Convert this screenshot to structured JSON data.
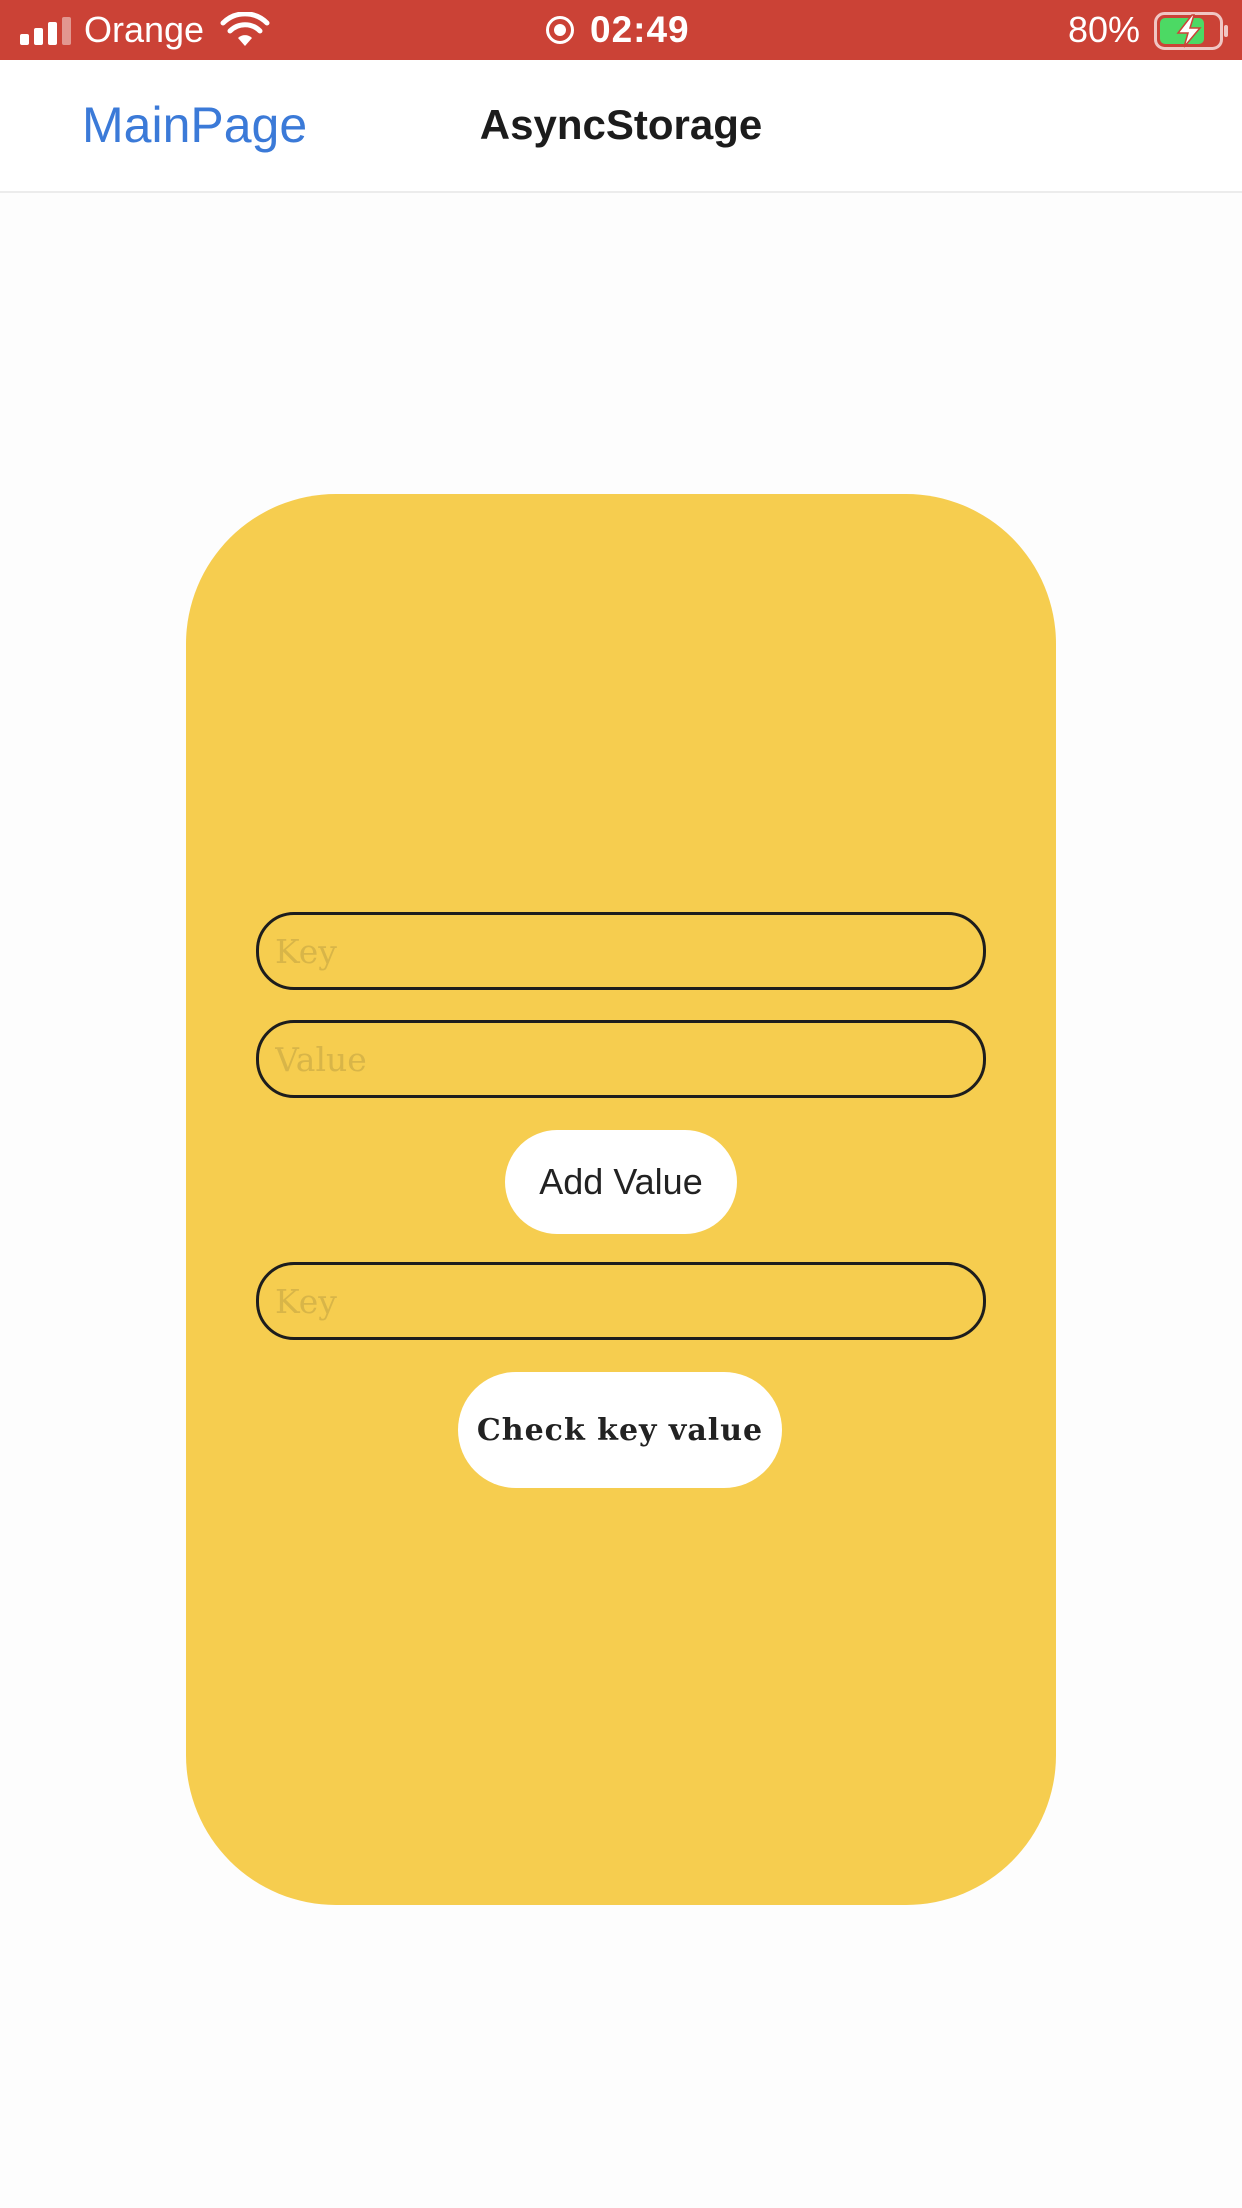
{
  "status_bar": {
    "carrier": "Orange",
    "time": "02:49",
    "battery_percent": "80%",
    "signal_icon": "cellular-signal-icon",
    "wifi_icon": "wifi-icon",
    "recording_icon": "screen-recording-icon",
    "battery_icon": "battery-charging-icon",
    "background_color": "#cb4236"
  },
  "header": {
    "back_label": "MainPage",
    "title": "AsyncStorage",
    "back_color": "#3b7ad8"
  },
  "card": {
    "background_color": "#f6cd4f",
    "key_input": {
      "placeholder": "Key",
      "value": ""
    },
    "value_input": {
      "placeholder": "Value",
      "value": ""
    },
    "add_button_label": "Add Value",
    "check_key_input": {
      "placeholder": "Key",
      "value": ""
    },
    "check_button_label": "Check key value"
  }
}
